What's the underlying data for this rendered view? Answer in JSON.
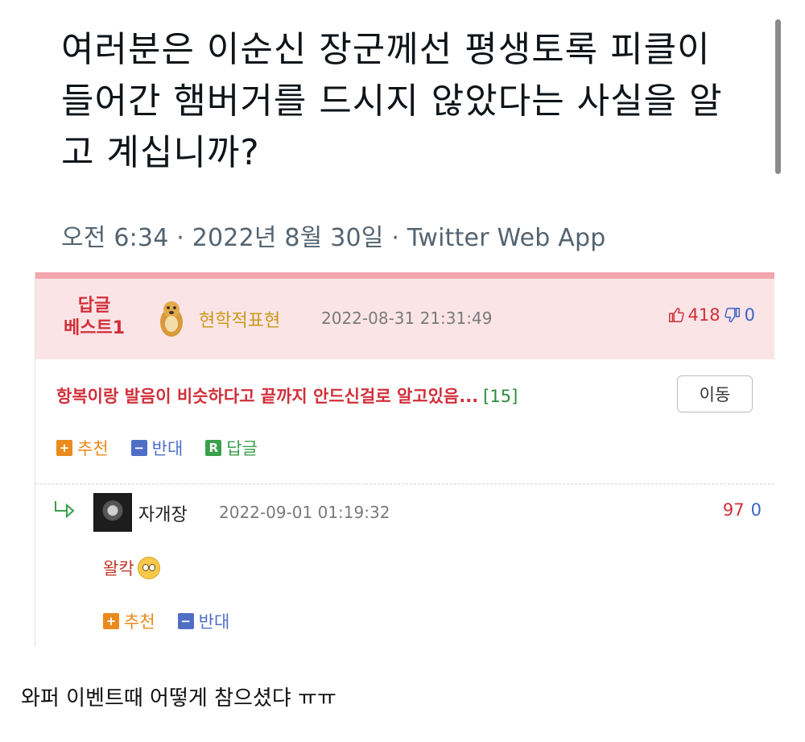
{
  "tweet": {
    "text": "여러분은 이순신 장군께선 평생토록 피클이 들어간 햄버거를 드시지 않았다는 사실을 알고 계십니까?",
    "meta": "오전 6:34 · 2022년 8월 30일 · Twitter Web App"
  },
  "best_comment": {
    "label_line1": "답글",
    "label_line2": "베스트1",
    "nickname": "현학적표현",
    "date": "2022-08-31 21:31:49",
    "up_icon": "thumbs-up-icon",
    "up_count": "418",
    "down_icon": "thumbs-down-icon",
    "down_count": "0",
    "text": "항복이랑 발음이 비슷하다고 끝까지 안드신걸로 알고있음...",
    "reply_count": "[15]",
    "move_button": "이동",
    "actions": {
      "recommend_icon": "+",
      "recommend": "추천",
      "oppose_icon": "−",
      "oppose": "반대",
      "reply_icon": "R",
      "reply": "답글"
    }
  },
  "reply_comment": {
    "arrow_icon": "reply-arrow-icon",
    "nickname": "자개장",
    "date": "2022-09-01 01:19:32",
    "up_count": "97",
    "down_count": "0",
    "text": "왈칵",
    "emoji_icon": "pleading-face-icon",
    "actions": {
      "recommend_icon": "+",
      "recommend": "추천",
      "oppose_icon": "−",
      "oppose": "반대"
    }
  },
  "caption": "와퍼 이벤트때 어떻게 참으셨댜 ㅠㅠ",
  "colors": {
    "accent_red": "#d12f3a",
    "best_bg": "#fbe4e6",
    "orange": "#ea8a1c",
    "blue": "#4f6fc7",
    "green": "#3aa04a"
  }
}
